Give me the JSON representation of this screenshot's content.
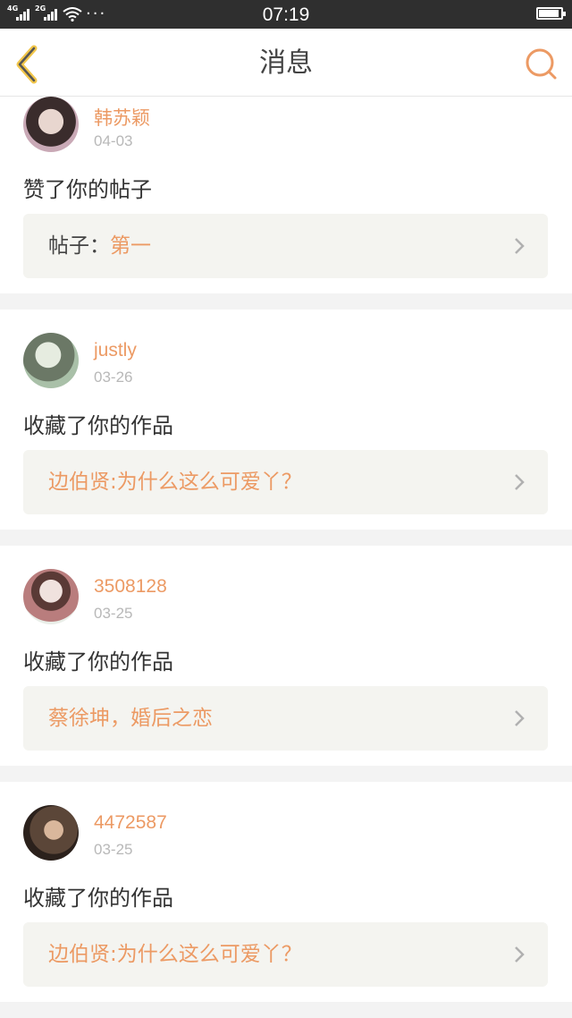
{
  "status_bar": {
    "network_labels": [
      "4G",
      "2G"
    ],
    "time": "07:19",
    "more": "···"
  },
  "header": {
    "title": "消息",
    "back_icon": "chevron-left-icon",
    "search_icon": "search-icon"
  },
  "notifications": [
    {
      "user": "韩苏颖",
      "date": "04-03",
      "action": "赞了你的帖子",
      "ref_prefix": "帖子：",
      "ref_title": "第一"
    },
    {
      "user": "justly",
      "date": "03-26",
      "action": "收藏了你的作品",
      "ref_prefix": "",
      "ref_title": "边伯贤:为什么这么可爱丫？"
    },
    {
      "user": "3508128",
      "date": "03-25",
      "action": "收藏了你的作品",
      "ref_prefix": "",
      "ref_title": "蔡徐坤，婚后之恋"
    },
    {
      "user": "4472587",
      "date": "03-25",
      "action": "收藏了你的作品",
      "ref_prefix": "",
      "ref_title": "边伯贤:为什么这么可爱丫？"
    }
  ],
  "colors": {
    "accent": "#ec9a64",
    "back_arrow": "#f2c64a",
    "status_bar": "#2f2f2f"
  }
}
